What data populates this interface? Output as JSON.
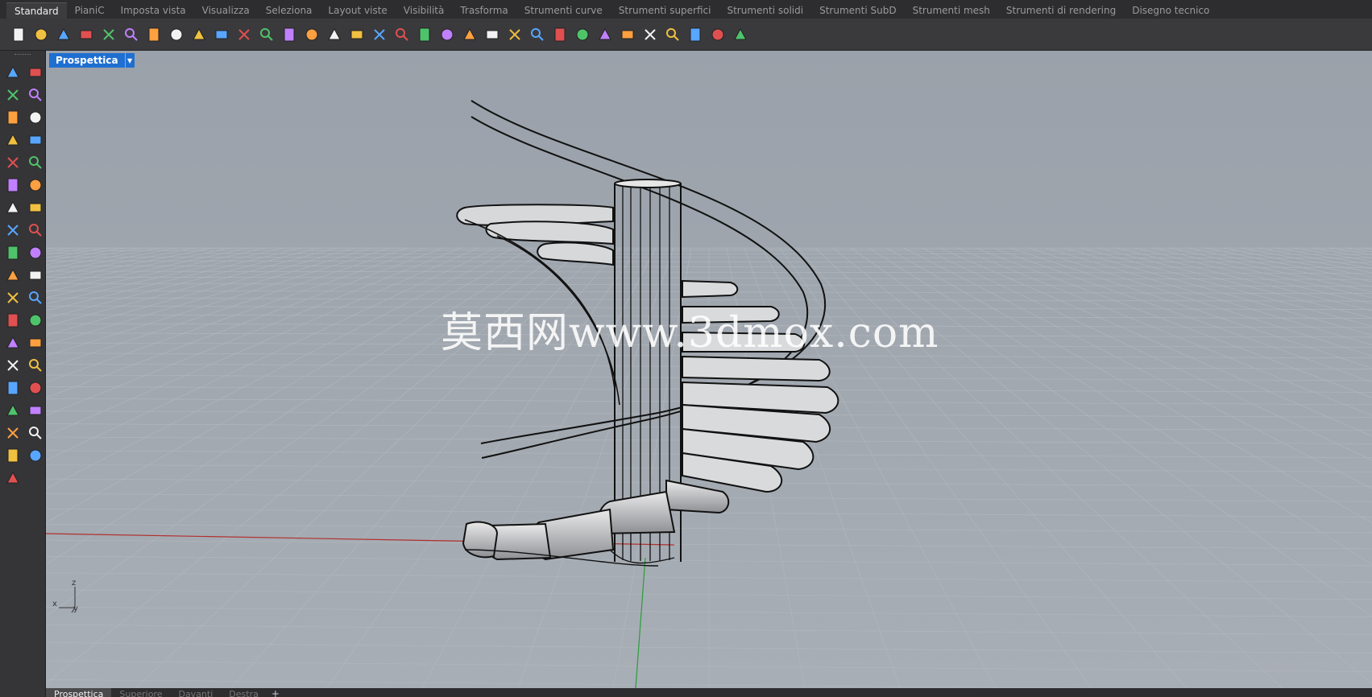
{
  "tabs": [
    {
      "label": "Standard",
      "active": true
    },
    {
      "label": "PianiC"
    },
    {
      "label": "Imposta vista"
    },
    {
      "label": "Visualizza"
    },
    {
      "label": "Seleziona"
    },
    {
      "label": "Layout viste"
    },
    {
      "label": "Visibilità"
    },
    {
      "label": "Trasforma"
    },
    {
      "label": "Strumenti curve"
    },
    {
      "label": "Strumenti superfici"
    },
    {
      "label": "Strumenti solidi"
    },
    {
      "label": "Strumenti SubD"
    },
    {
      "label": "Strumenti mesh"
    },
    {
      "label": "Strumenti di rendering"
    },
    {
      "label": "Disegno tecnico"
    }
  ],
  "toolbar_icons": [
    "new-file-icon",
    "open-folder-icon",
    "save-icon",
    "print-icon",
    "import-icon",
    "cut-icon",
    "copy-icon",
    "paste-icon",
    "undo-icon",
    "pan-hand-icon",
    "rotate-view-icon",
    "zoom-icon",
    "zoom-window-icon",
    "zoom-extents-icon",
    "zoom-selected-icon",
    "zoom-previous-icon",
    "viewport-layout-icon",
    "car-view-icon",
    "named-view-icon",
    "cplane-icon",
    "snap-icon",
    "light-icon",
    "lock-icon",
    "layer-icon",
    "color-wheel-icon",
    "shaded-sphere-icon",
    "rendered-icon",
    "render-icon",
    "material-icon",
    "settings-icon",
    "grid-options-icon",
    "earth-icon",
    "help-icon"
  ],
  "left_tools": [
    "select-arrow-icon",
    "point-icon",
    "polyline-icon",
    "curve-icon",
    "circle-icon",
    "ellipse-icon",
    "arc-icon",
    "rectangle-icon",
    "polygon-icon",
    "fillet-icon",
    "surface-icon",
    "extrude-icon",
    "box-icon",
    "sphere-icon",
    "cylinder-icon",
    "mesh-icon",
    "explode-icon",
    "boolean-icon",
    "split-icon",
    "trim-icon",
    "group-icon",
    "array-icon",
    "offset-icon",
    "blend-icon",
    "text-icon",
    "dimension-icon",
    "transform-icon",
    "mirror-icon",
    "block-icon",
    "fence-icon",
    "grid-array-icon",
    "align-icon",
    "analyze-icon",
    "render-mesh-icon",
    "check-icon",
    "shade-icon",
    "paint-icon"
  ],
  "viewport": {
    "label": "Prospettica",
    "watermark": "莫西网www.3dmox.com",
    "axis_x": "x",
    "axis_y": "y",
    "axis_z": "z"
  },
  "viewport_tabs": [
    {
      "label": "Prospettica",
      "active": true
    },
    {
      "label": "Superiore"
    },
    {
      "label": "Davanti"
    },
    {
      "label": "Destra"
    }
  ],
  "add_tab": "+",
  "colors": {
    "accent": "#1f6fd1",
    "x_axis": "#b03030",
    "y_axis": "#2a9d3a",
    "grid": "#9aa0a8"
  }
}
